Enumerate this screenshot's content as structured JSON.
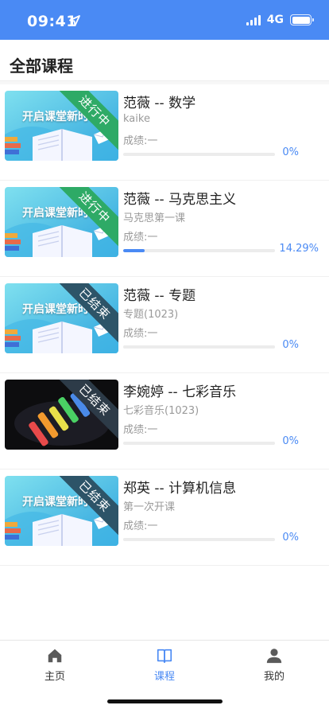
{
  "status_bar": {
    "time": "09:41",
    "network": "4G"
  },
  "header": {
    "title": "全部课程"
  },
  "courses": [
    {
      "title": "范薇 -- 数学",
      "subtitle": "kaike",
      "score": "成绩:一",
      "badge": "进行中",
      "progress_percent": 0,
      "progress_label": "0%",
      "thumbnail": "banner",
      "badge_color": "#2eaa66"
    },
    {
      "title": "范薇 -- 马克思主义",
      "subtitle": "马克思第一课",
      "score": "成绩:一",
      "badge": "进行中",
      "progress_percent": 14.29,
      "progress_label": "14.29%",
      "thumbnail": "banner",
      "badge_color": "#2eaa66"
    },
    {
      "title": "范薇 -- 专题",
      "subtitle": "专题(1023)",
      "score": "成绩:一",
      "badge": "已结束",
      "progress_percent": 0,
      "progress_label": "0%",
      "thumbnail": "banner",
      "badge_color": "#2d5468"
    },
    {
      "title": "李婉婷 -- 七彩音乐",
      "subtitle": "七彩音乐(1023)",
      "score": "成绩:一",
      "badge": "已结束",
      "progress_percent": 0,
      "progress_label": "0%",
      "thumbnail": "chalk",
      "badge_color": "#2d3b48"
    },
    {
      "title": "郑英 -- 计算机信息",
      "subtitle": "第一次开课",
      "score": "成绩:一",
      "badge": "已结束",
      "progress_percent": 0,
      "progress_label": "0%",
      "thumbnail": "banner",
      "badge_color": "#2d5468"
    }
  ],
  "thumbnail_text": "开启课堂新时代",
  "tab_bar": {
    "tabs": [
      {
        "label": "主页",
        "icon": "home-icon",
        "active": false
      },
      {
        "label": "课程",
        "icon": "book-icon",
        "active": true
      },
      {
        "label": "我的",
        "icon": "person-icon",
        "active": false
      }
    ]
  },
  "colors": {
    "accent": "#4a8af4",
    "text": "#222222",
    "muted": "#9a9a9a"
  }
}
